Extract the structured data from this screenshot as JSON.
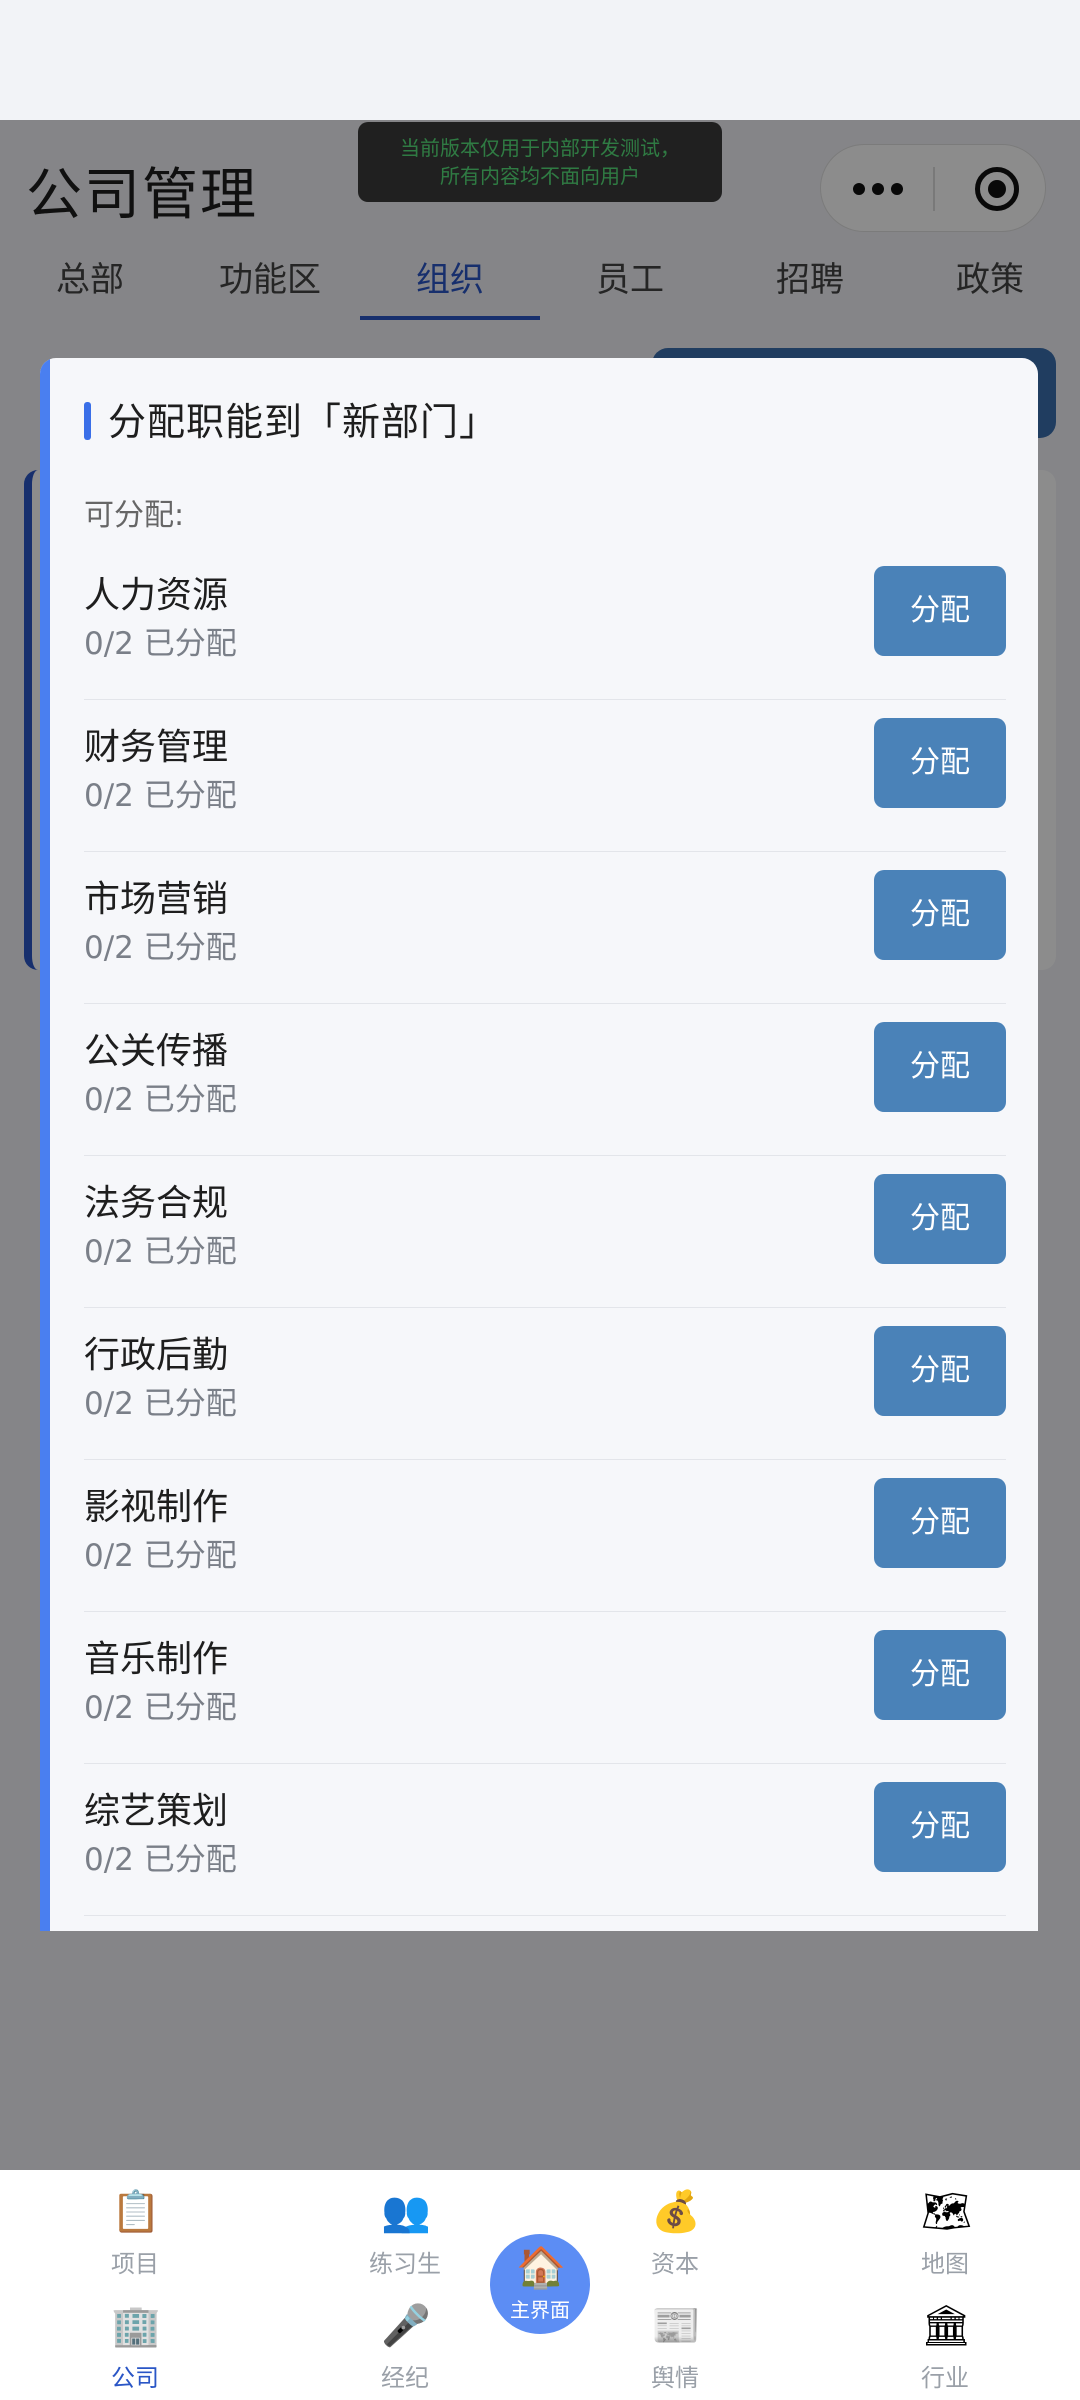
{
  "header": {
    "title": "公司管理",
    "dev_banner_line1": "当前版本仅用于内部开发测试，",
    "dev_banner_line2": "所有内容均不面向用户"
  },
  "tabs": [
    {
      "label": "总部",
      "active": false
    },
    {
      "label": "功能区",
      "active": false
    },
    {
      "label": "组织",
      "active": true
    },
    {
      "label": "员工",
      "active": false
    },
    {
      "label": "招聘",
      "active": false
    },
    {
      "label": "政策",
      "active": false
    }
  ],
  "modal": {
    "title": "分配职能到「新部门」",
    "section_label": "可分配:",
    "button_label": "分配",
    "functions": [
      {
        "name": "人力资源",
        "count": "0/2 已分配"
      },
      {
        "name": "财务管理",
        "count": "0/2 已分配"
      },
      {
        "name": "市场营销",
        "count": "0/2 已分配"
      },
      {
        "name": "公关传播",
        "count": "0/2 已分配"
      },
      {
        "name": "法务合规",
        "count": "0/2 已分配"
      },
      {
        "name": "行政后勤",
        "count": "0/2 已分配"
      },
      {
        "name": "影视制作",
        "count": "0/2 已分配"
      },
      {
        "name": "音乐制作",
        "count": "0/2 已分配"
      },
      {
        "name": "综艺策划",
        "count": "0/2 已分配"
      }
    ]
  },
  "bottom_nav": {
    "top_row": [
      {
        "label": "项目",
        "icon": "clipboard-icon",
        "glyph": "📋"
      },
      {
        "label": "练习生",
        "icon": "trainee-icon",
        "glyph": "👥"
      },
      {
        "label": "资本",
        "icon": "money-bag-icon",
        "glyph": "💰"
      },
      {
        "label": "地图",
        "icon": "map-icon",
        "glyph": "🗺"
      }
    ],
    "bottom_row": [
      {
        "label": "公司",
        "icon": "office-building-icon",
        "glyph": "🏢",
        "active": true
      },
      {
        "label": "经纪",
        "icon": "microphone-icon",
        "glyph": "🎤",
        "active": false
      },
      {
        "label": "舆情",
        "icon": "newspaper-icon",
        "glyph": "📰",
        "active": false
      },
      {
        "label": "行业",
        "icon": "bank-icon",
        "glyph": "🏛",
        "active": false
      }
    ],
    "home": {
      "label": "主界面",
      "icon": "house-icon",
      "glyph": "🏠"
    }
  },
  "colors": {
    "accent": "#2a56c6",
    "button": "#4a82b8",
    "modal_bar": "#4a7ff0",
    "banner_text": "#57e07a"
  }
}
